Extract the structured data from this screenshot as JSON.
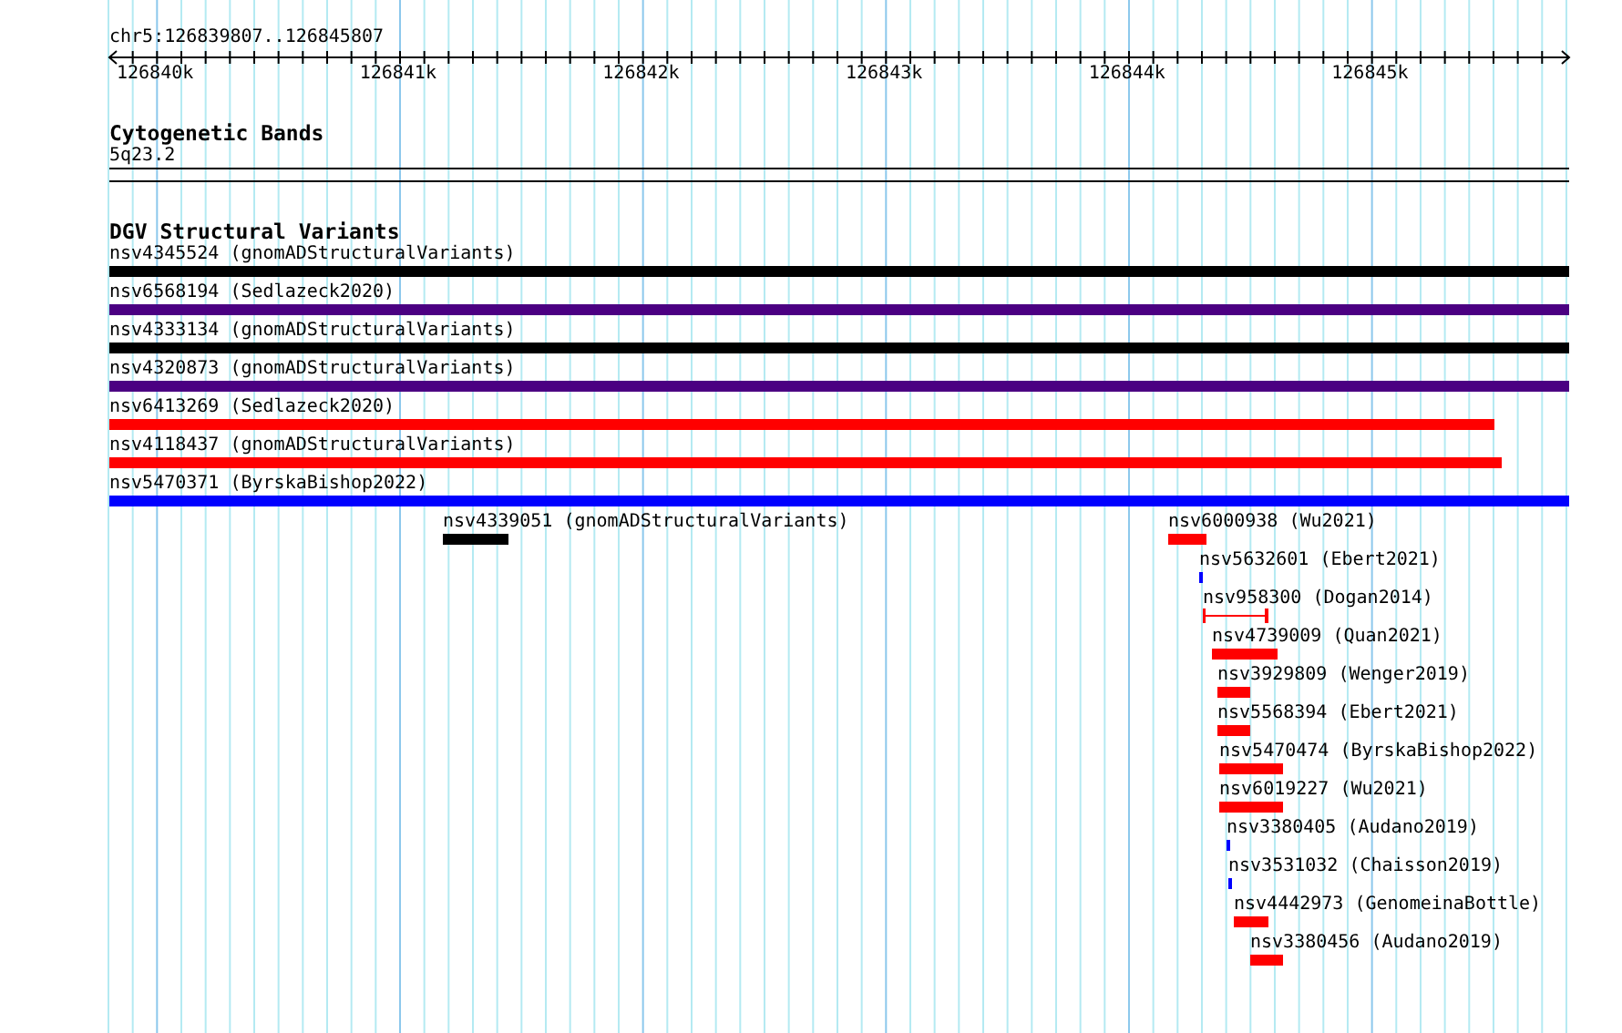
{
  "region": "chr5:126839807..126845807",
  "ruler": {
    "ticks": [
      "126840k",
      "126841k",
      "126842k",
      "126843k",
      "126844k",
      "126845k"
    ]
  },
  "tracks": [
    {
      "title": "Cytogenetic Bands",
      "kind": "bands",
      "features": [
        {
          "label": "5q23.2"
        }
      ]
    },
    {
      "title": "DGV Structural Variants",
      "kind": "variants",
      "features": [
        {
          "label": "nsv4345524 (gnomADStructuralVariants)",
          "color": "#000000",
          "kind": "bar"
        },
        {
          "label": "nsv6568194 (Sedlazeck2020)",
          "color": "#4b0082",
          "kind": "bar"
        },
        {
          "label": "nsv4333134 (gnomADStructuralVariants)",
          "color": "#000000",
          "kind": "bar"
        },
        {
          "label": "nsv4320873 (gnomADStructuralVariants)",
          "color": "#4b0082",
          "kind": "bar"
        },
        {
          "label": "nsv6413269 (Sedlazeck2020)",
          "color": "#ff0000",
          "kind": "bar"
        },
        {
          "label": "nsv4118437 (gnomADStructuralVariants)",
          "color": "#ff0000",
          "kind": "bar"
        },
        {
          "label": "nsv5470371 (ByrskaBishop2022)",
          "color": "#0000ff",
          "kind": "bar"
        },
        {
          "label": "nsv4339051 (gnomADStructuralVariants)",
          "color": "#000000",
          "kind": "bar"
        },
        {
          "label": "nsv6000938 (Wu2021)",
          "color": "#ff0000",
          "kind": "bar"
        },
        {
          "label": "nsv5632601 (Ebert2021)",
          "color": "#0000ff",
          "kind": "bar"
        },
        {
          "label": "nsv958300 (Dogan2014)",
          "color": "#ff0000",
          "kind": "interval"
        },
        {
          "label": "nsv4739009 (Quan2021)",
          "color": "#ff0000",
          "kind": "bar"
        },
        {
          "label": "nsv3929809 (Wenger2019)",
          "color": "#ff0000",
          "kind": "bar"
        },
        {
          "label": "nsv5568394 (Ebert2021)",
          "color": "#ff0000",
          "kind": "bar"
        },
        {
          "label": "nsv5470474 (ByrskaBishop2022)",
          "color": "#ff0000",
          "kind": "bar"
        },
        {
          "label": "nsv6019227 (Wu2021)",
          "color": "#ff0000",
          "kind": "bar"
        },
        {
          "label": "nsv3380405 (Audano2019)",
          "color": "#0000ff",
          "kind": "bar"
        },
        {
          "label": "nsv3531032 (Chaisson2019)",
          "color": "#0000ff",
          "kind": "bar"
        },
        {
          "label": "nsv4442973 (GenomeinaBottle)",
          "color": "#ff0000",
          "kind": "bar"
        },
        {
          "label": "nsv3380456 (Audano2019)",
          "color": "#ff0000",
          "kind": "bar"
        }
      ]
    }
  ]
}
